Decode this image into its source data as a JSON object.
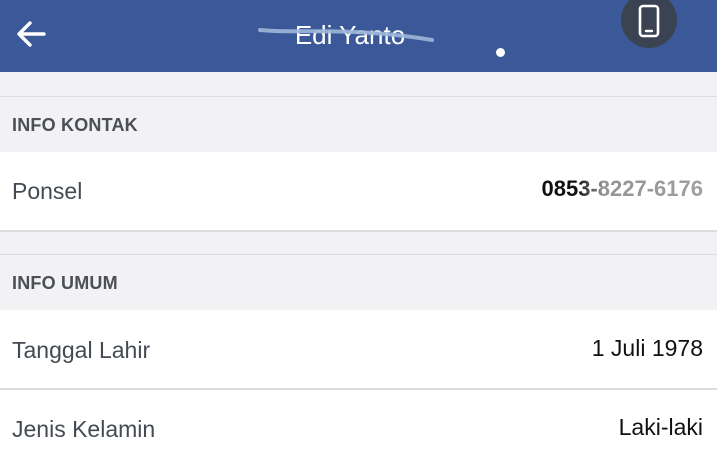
{
  "header": {
    "back_icon": "arrow-left-icon",
    "title": "Edi Yanto",
    "device_icon": "smartphone-icon",
    "background": "#3b5998"
  },
  "sections": {
    "contact": {
      "title": "INFO KONTAK",
      "rows": [
        {
          "label": "Ponsel",
          "value": "0853-8227-6176"
        }
      ]
    },
    "general": {
      "title": "INFO UMUM",
      "rows": [
        {
          "label": "Tanggal Lahir",
          "value": "1 Juli 1978"
        },
        {
          "label": "Jenis Kelamin",
          "value": "Laki-laki"
        }
      ]
    }
  }
}
